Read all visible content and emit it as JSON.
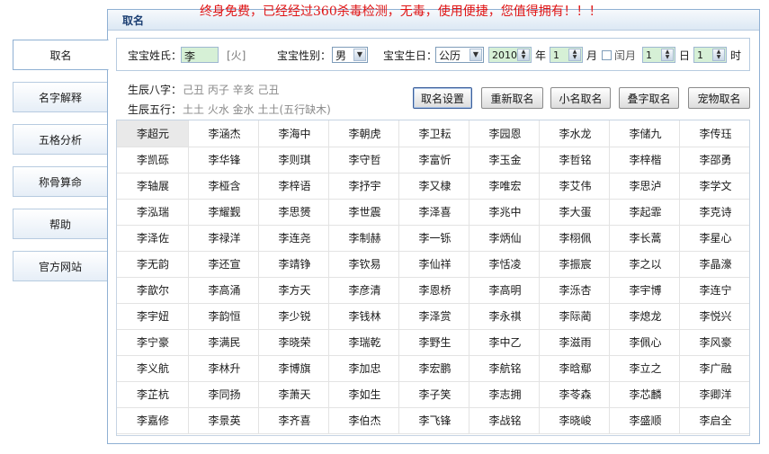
{
  "slogan": "终身免费，已经经过360杀毒检测，无毒，使用便捷，您值得拥有！！！",
  "nav": {
    "items": [
      "取名",
      "名字解释",
      "五格分析",
      "称骨算命",
      "帮助",
      "官方网站"
    ],
    "active_index": 0
  },
  "panel": {
    "title": "取名"
  },
  "form": {
    "surname_label": "宝宝姓氏：",
    "surname_value": "李",
    "surname_element": "[火]",
    "gender_label": "宝宝性别：",
    "gender_value": "男",
    "birth_label": "宝宝生日：",
    "calendar_value": "公历",
    "year_value": "2010",
    "year_unit": "年",
    "month_value": "1",
    "month_unit": "月",
    "leap_label": "闰月",
    "day_value": "1",
    "day_unit": "日",
    "hour_value": "1",
    "hour_unit": "时"
  },
  "info": {
    "bazi_label": "生辰八字：",
    "bazi_value": "己丑  丙子  辛亥  己丑",
    "wuxing_label": "生辰五行：",
    "wuxing_value": "土土  火水  金水  土土(五行缺木)"
  },
  "actions": [
    "取名设置",
    "重新取名",
    "小名取名",
    "叠字取名",
    "宠物取名"
  ],
  "names": [
    [
      "李超元",
      "李涵杰",
      "李海中",
      "李朝虎",
      "李卫耘",
      "李园恩",
      "李水龙",
      "李储九",
      "李传珏"
    ],
    [
      "李凯砾",
      "李华锋",
      "李则琪",
      "李守哲",
      "李富忻",
      "李玉金",
      "李哲铭",
      "李梓楷",
      "李邵勇"
    ],
    [
      "李轴展",
      "李桠含",
      "李梓语",
      "李抒宇",
      "李又棣",
      "李唯宏",
      "李艾伟",
      "李思泸",
      "李学文"
    ],
    [
      "李泓瑞",
      "李耀觐",
      "李思赟",
      "李世震",
      "李泽喜",
      "李兆中",
      "李大蛋",
      "李起霏",
      "李克诗"
    ],
    [
      "李泽佐",
      "李禄洋",
      "李连尧",
      "李制赫",
      "李一铄",
      "李炳仙",
      "李栩佩",
      "李长蒿",
      "李星心"
    ],
    [
      "李无韵",
      "李还宣",
      "李靖铮",
      "李钦易",
      "李仙祥",
      "李恬凌",
      "李振宸",
      "李之以",
      "李晶濠"
    ],
    [
      "李歆尔",
      "李高涌",
      "李方天",
      "李彦清",
      "李恩桥",
      "李高明",
      "李泺杏",
      "李宇博",
      "李连宁"
    ],
    [
      "李宇妞",
      "李韵恒",
      "李少锐",
      "李钱林",
      "李泽赏",
      "李永祺",
      "李际蔺",
      "李熄龙",
      "李悦兴"
    ],
    [
      "李宁豪",
      "李满民",
      "李晓荣",
      "李瑞乾",
      "李野生",
      "李中乙",
      "李滋雨",
      "李佩心",
      "李风豪"
    ],
    [
      "李义航",
      "李林升",
      "李博旗",
      "李加忠",
      "李宏鹏",
      "李航铭",
      "李晗鄢",
      "李立之",
      "李广融"
    ],
    [
      "李芷杭",
      "李同扬",
      "李萧天",
      "李如生",
      "李子笑",
      "李志拥",
      "李苓森",
      "李芯麟",
      "李卿洋"
    ],
    [
      "李嘉修",
      "李景英",
      "李齐喜",
      "李伯杰",
      "李飞锋",
      "李战铭",
      "李晓峻",
      "李盛顺",
      "李启全"
    ]
  ],
  "selected_name": "李超元"
}
